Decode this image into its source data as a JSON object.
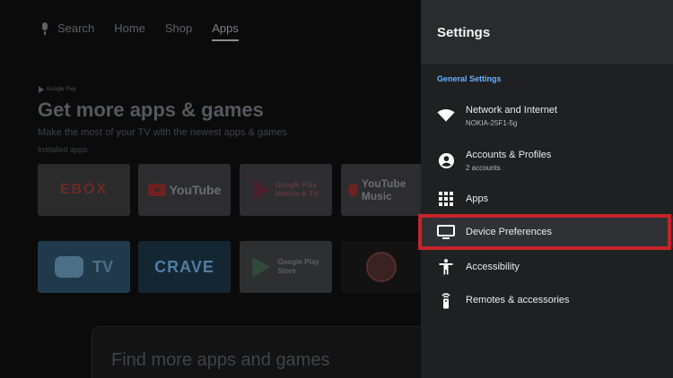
{
  "home": {
    "nav": {
      "search": "Search",
      "home": "Home",
      "shop": "Shop",
      "apps": "Apps",
      "active": "apps"
    },
    "google_play_badge": "Google Play",
    "headline": "Get more apps & games",
    "subline": "Make the most of your TV with the newest apps & games",
    "installed_label": "Installed apps",
    "tiles": {
      "ebox": "EBŌX",
      "youtube": "YouTube",
      "play_movies": "Google Play\nMovies & TV",
      "youtube_music": "YouTube Music",
      "tv": "TV",
      "crave": "CRAVE",
      "play_store": "Google Play\nStore"
    },
    "find_more": "Find more apps and games"
  },
  "settings": {
    "title": "Settings",
    "section_label": "General Settings",
    "accent_color": "#66b2ff",
    "items": [
      {
        "label": "Network and Internet",
        "sublabel": "NOKIA-25F1-5g",
        "icon": "wifi-icon"
      },
      {
        "label": "Accounts & Profiles",
        "sublabel": "2 accounts",
        "icon": "account-circle-icon"
      },
      {
        "label": "Apps",
        "sublabel": "",
        "icon": "apps-grid-icon"
      },
      {
        "label": "Device Preferences",
        "sublabel": "",
        "icon": "monitor-icon",
        "focused": true
      },
      {
        "label": "Accessibility",
        "sublabel": "",
        "icon": "accessibility-icon"
      },
      {
        "label": "Remotes & accessories",
        "sublabel": "",
        "icon": "remote-icon"
      }
    ],
    "highlight_color": "#c4242b"
  }
}
